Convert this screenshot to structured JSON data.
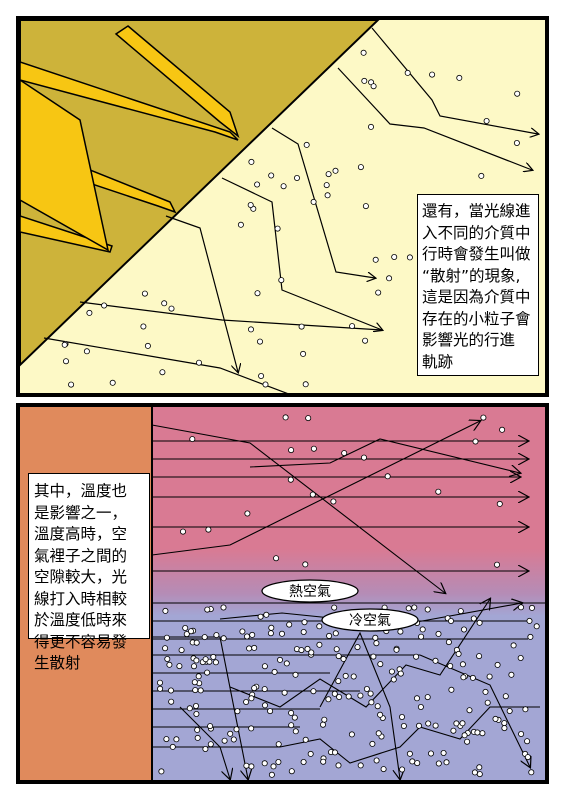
{
  "top_panel": {
    "caption_lines": [
      "還有，當光線進",
      "入不同的介質中",
      "行時會發生叫做",
      "“散射”的現象,",
      "這是因為介質中",
      "存在的小粒子會",
      "影響光的行進",
      "軌跡"
    ]
  },
  "bottom_panel": {
    "caption_lines": [
      "其中，溫度也",
      "是影響之一，",
      "溫度高時，空",
      "氣裡子之間的",
      "空隙較大，光",
      "線打入時相較",
      "於溫度低時來",
      "得更不容易發",
      "生散射"
    ],
    "hot_air_label": "熱空氣",
    "cold_air_label": "冷空氣"
  },
  "colors": {
    "light_source": "#cdb33a",
    "beam_yellow": "#f7c613",
    "medium_top": "#fdf9c6",
    "hot_air": "#d97a93",
    "cold_air": "#a3a6d4",
    "wall": "#e08a5c"
  }
}
